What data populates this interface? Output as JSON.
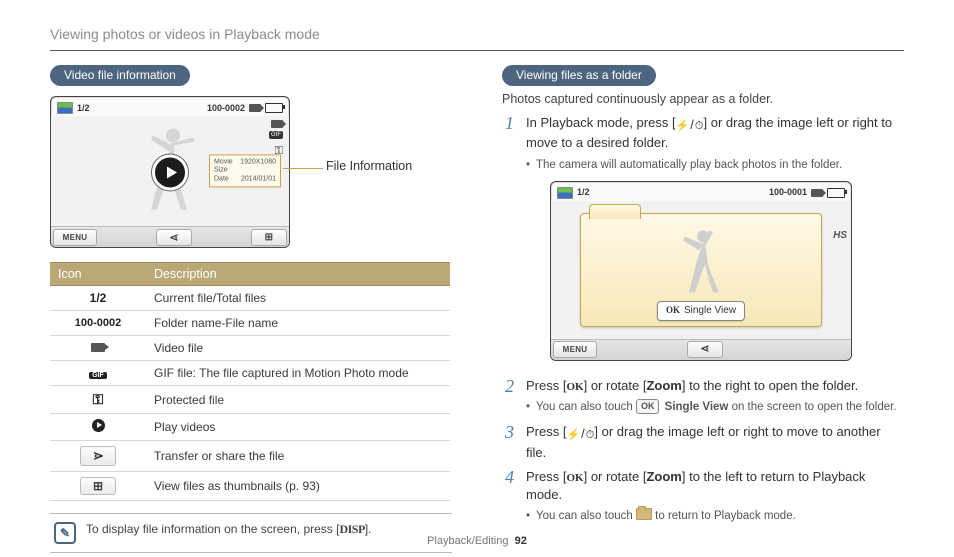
{
  "breadcrumb": "Viewing photos or videos in Playback mode",
  "left": {
    "section_title": "Video file information",
    "callout": "File Information",
    "lcd": {
      "counter": "1/2",
      "folder_file": "100-0002",
      "menu": "MENU",
      "info_box": {
        "label1": "Movie Size",
        "val1": "1920X1080",
        "label2": "Date",
        "val2": "2014/01/01"
      }
    },
    "table": {
      "h1": "Icon",
      "h2": "Description",
      "rows": {
        "r0": {
          "icon": "1/2",
          "desc": "Current file/Total files"
        },
        "r1": {
          "icon": "100-0002",
          "desc": "Folder name-File name"
        },
        "r2": {
          "desc": "Video file"
        },
        "r3": {
          "desc": "GIF file: The file captured in Motion Photo mode"
        },
        "r4": {
          "desc": "Protected file"
        },
        "r5": {
          "desc": "Play videos"
        },
        "r6": {
          "desc": "Transfer or share the file"
        },
        "r7": {
          "desc": "View files as thumbnails (p. 93)"
        }
      }
    },
    "note_pre": "To display file information on the screen, press [",
    "note_disp": "DISP",
    "note_post": "]."
  },
  "right": {
    "section_title": "Viewing files as a folder",
    "subtitle": "Photos captured continuously appear as a folder.",
    "lcd2": {
      "counter": "1/2",
      "folder_file": "100-0001",
      "menu": "MENU",
      "hs": "HS",
      "ok": "OK",
      "single_view": "Single View"
    },
    "steps": {
      "s1": {
        "text_a": "In Playback mode, press [",
        "text_b": "] or drag the image left or right to move to a desired folder.",
        "sub1": "The camera will automatically play back photos in the folder."
      },
      "s2": {
        "text_a": "Press [",
        "ok": "OK",
        "text_b": "] or rotate [",
        "zoom": "Zoom",
        "text_c": "] to the right to open the folder.",
        "sub1_a": "You can also touch ",
        "sub1_ok": "OK",
        "sub1_b": " Single View",
        "sub1_c": " on the screen to open the folder."
      },
      "s3": {
        "text_a": "Press [",
        "text_b": "] or drag the image left or right to move to another file."
      },
      "s4": {
        "text_a": "Press [",
        "ok": "OK",
        "text_b": "] or rotate [",
        "zoom": "Zoom",
        "text_c": "] to the left to return to Playback mode.",
        "sub1_a": "You can also touch ",
        "sub1_b": " to return to Playback mode."
      }
    }
  },
  "footer": {
    "section": "Playback/Editing",
    "page": "92"
  }
}
